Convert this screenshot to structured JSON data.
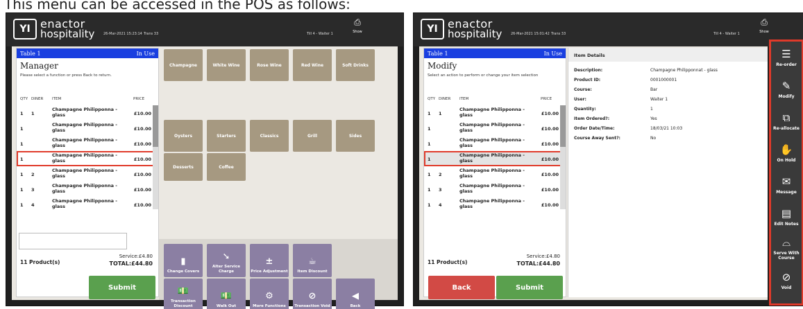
{
  "caption": "This menu can be accessed in the POS as follows:",
  "header": {
    "logo_line1": "enactor",
    "logo_line2": "hospitality",
    "logo_mark": "YI",
    "printer_label": "Show"
  },
  "left": {
    "datetime": "26-Mar-2021 15:23:14",
    "trans": "Trans 33",
    "till": "Till 4 - Waiter 1",
    "table_name": "Table 1",
    "table_status": "In Use",
    "mode_title": "Manager",
    "hint": "Please select a function or press Back to return.",
    "columns": {
      "qty": "QTY",
      "diner": "DINER",
      "item": "ITEM",
      "price": "PRICE"
    },
    "rows": [
      {
        "qty": "1",
        "diner": "1",
        "item": "Champagne Philipponna - glass",
        "price": "£10.00"
      },
      {
        "qty": "1",
        "diner": "",
        "item": "Champagne Philipponna - glass",
        "price": "£10.00"
      },
      {
        "qty": "1",
        "diner": "",
        "item": "Champagne Philipponna - glass",
        "price": "£10.00"
      },
      {
        "qty": "1",
        "diner": "",
        "item": "Champagne Philipponna - glass",
        "price": "£10.00"
      },
      {
        "qty": "1",
        "diner": "2",
        "item": "Champagne Philipponna - glass",
        "price": "£10.00"
      },
      {
        "qty": "1",
        "diner": "3",
        "item": "Champagne Philipponna - glass",
        "price": "£10.00"
      },
      {
        "qty": "1",
        "diner": "4",
        "item": "Champagne Philipponna - glass",
        "price": "£10.00"
      }
    ],
    "product_count": "11 Product(s)",
    "service": "Service:£4.80",
    "total": "TOTAL:£44.80",
    "submit": "Submit",
    "tiles_row1": [
      "Champagne",
      "White Wine",
      "Rose Wine",
      "Red Wine",
      "Soft Drinks"
    ],
    "tiles_row2": [
      "Oysters",
      "Starters",
      "Classics",
      "Grill",
      "Sides"
    ],
    "tiles_row3": [
      "Desserts",
      "Coffee"
    ],
    "funcs_row1": [
      {
        "label": "Change Covers",
        "icon": "covers-icon",
        "glyph": "▮"
      },
      {
        "label": "Alter Service Charge",
        "icon": "service-charge-icon",
        "glyph": "➘"
      },
      {
        "label": "Price Adjustment",
        "icon": "price-adjust-icon",
        "glyph": "±"
      },
      {
        "label": "Item Discount",
        "icon": "item-discount-icon",
        "glyph": "☕"
      }
    ],
    "funcs_row2": [
      {
        "label": "Transaction Discount",
        "icon": "cash-icon",
        "glyph": "💵"
      },
      {
        "label": "Walk Out",
        "icon": "walk-out-icon",
        "glyph": "💵"
      },
      {
        "label": "More Functions",
        "icon": "gears-icon",
        "glyph": "⚙"
      },
      {
        "label": "Transaction Void",
        "icon": "void-icon",
        "glyph": "⊘"
      },
      {
        "label": "Back",
        "icon": "back-icon",
        "glyph": "◀"
      }
    ]
  },
  "right": {
    "datetime": "26-Mar-2021 15:01:42",
    "trans": "Trans 33",
    "till": "Till 4 - Waiter 1",
    "table_name": "Table 1",
    "table_status": "In Use",
    "mode_title": "Modify",
    "hint": "Select an action to perform or change your item selection",
    "columns": {
      "qty": "QTY",
      "diner": "DINER",
      "item": "ITEM",
      "price": "PRICE"
    },
    "rows": [
      {
        "qty": "1",
        "diner": "1",
        "item": "Champagne Philipponna - glass",
        "price": "£10.00"
      },
      {
        "qty": "1",
        "diner": "",
        "item": "Champagne Philipponna - glass",
        "price": "£10.00"
      },
      {
        "qty": "1",
        "diner": "",
        "item": "Champagne Philipponna - glass",
        "price": "£10.00"
      },
      {
        "qty": "1",
        "diner": "",
        "item": "Champagne Philipponna - glass",
        "price": "£10.00"
      },
      {
        "qty": "1",
        "diner": "2",
        "item": "Champagne Philipponna - glass",
        "price": "£10.00"
      },
      {
        "qty": "1",
        "diner": "3",
        "item": "Champagne Philipponna - glass",
        "price": "£10.00"
      },
      {
        "qty": "1",
        "diner": "4",
        "item": "Champagne Philipponna - glass",
        "price": "£10.00"
      }
    ],
    "product_count": "11 Product(s)",
    "service": "Service:£4.80",
    "total": "TOTAL:£44.80",
    "back": "Back",
    "submit": "Submit",
    "details_title": "Item Details",
    "details": [
      {
        "key": "Description:",
        "value": "Champagne Philipponnat - glass"
      },
      {
        "key": "Product ID:",
        "value": "0001000001"
      },
      {
        "key": "Course:",
        "value": "Bar"
      },
      {
        "key": "User:",
        "value": "Waiter 1"
      },
      {
        "key": "Quantity:",
        "value": "1"
      },
      {
        "key": "Item Ordered?:",
        "value": "Yes"
      },
      {
        "key": "Order Date/Time:",
        "value": "18/03/21 10:03"
      },
      {
        "key": "Course Away Sent?:",
        "value": "No"
      }
    ],
    "sidebar": [
      {
        "label": "Re-order",
        "icon": "reorder-icon",
        "glyph": "☰"
      },
      {
        "label": "Modify",
        "icon": "pencil-icon",
        "glyph": "✎"
      },
      {
        "label": "Re-allocate",
        "icon": "reallocate-icon",
        "glyph": "⧉"
      },
      {
        "label": "On Hold",
        "icon": "hand-icon",
        "glyph": "✋"
      },
      {
        "label": "Message",
        "icon": "message-icon",
        "glyph": "✉"
      },
      {
        "label": "Edit Notes",
        "icon": "notes-icon",
        "glyph": "▤"
      },
      {
        "label": "Serve With Course",
        "icon": "cloche-icon",
        "glyph": "⌓"
      },
      {
        "label": "Void",
        "icon": "void-icon",
        "glyph": "⊘"
      }
    ]
  },
  "colors": {
    "table_bar": "#1a3fe0",
    "tile": "#a69981",
    "function_button": "#8b7fa3",
    "submit": "#5aa04e",
    "back": "#d24a45",
    "highlight": "#e03a2a"
  }
}
